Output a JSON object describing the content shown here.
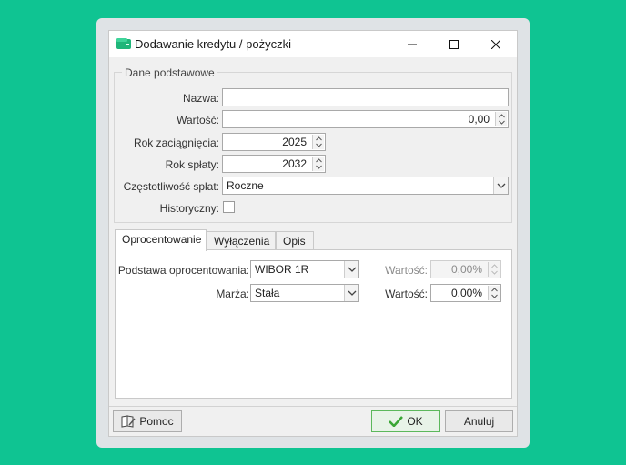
{
  "window": {
    "title": "Dodawanie kredytu / pożyczki",
    "accent_color": "#0fc492"
  },
  "basic": {
    "group_title": "Dane podstawowe",
    "name_label": "Nazwa:",
    "name_value": "",
    "value_label": "Wartość:",
    "value": "0,00",
    "year_taken_label": "Rok zaciągnięcia:",
    "year_taken": "2025",
    "year_repaid_label": "Rok spłaty:",
    "year_repaid": "2032",
    "frequency_label": "Częstotliwość spłat:",
    "frequency": "Roczne",
    "historical_label": "Historyczny:",
    "historical_checked": false
  },
  "tabs": [
    {
      "label": "Oprocentowanie",
      "active": true
    },
    {
      "label": "Wyłączenia",
      "active": false
    },
    {
      "label": "Opis",
      "active": false
    }
  ],
  "interest": {
    "basis_label": "Podstawa oprocentowania:",
    "basis_value": "WIBOR 1R",
    "basis_rate_label": "Wartość:",
    "basis_rate": "0,00%",
    "margin_label": "Marża:",
    "margin_value": "Stała",
    "margin_rate_label": "Wartość:",
    "margin_rate": "0,00%"
  },
  "footer": {
    "help_label": "Pomoc",
    "ok_label": "OK",
    "cancel_label": "Anuluj"
  }
}
